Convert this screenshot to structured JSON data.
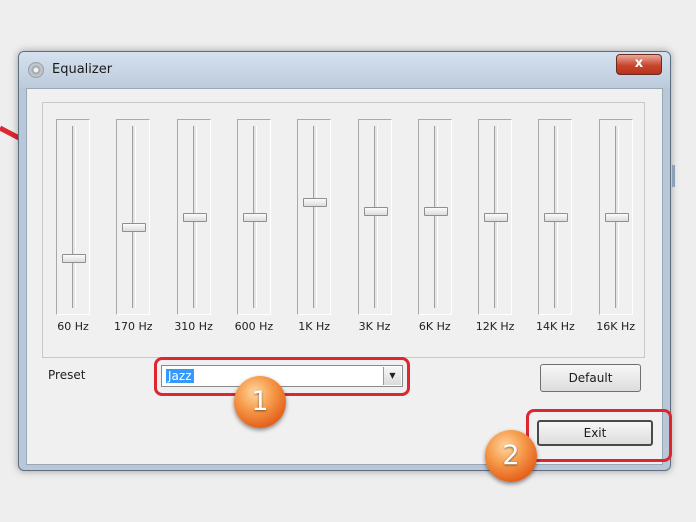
{
  "window": {
    "title": "Equalizer",
    "close_label": "x"
  },
  "bands": [
    {
      "label": "60 Hz",
      "level": 0.27
    },
    {
      "label": "170 Hz",
      "level": 0.44
    },
    {
      "label": "310 Hz",
      "level": 0.5
    },
    {
      "label": "600 Hz",
      "level": 0.5
    },
    {
      "label": "1K Hz",
      "level": 0.58
    },
    {
      "label": "3K Hz",
      "level": 0.53
    },
    {
      "label": "6K Hz",
      "level": 0.53
    },
    {
      "label": "12K Hz",
      "level": 0.5
    },
    {
      "label": "14K Hz",
      "level": 0.5
    },
    {
      "label": "16K Hz",
      "level": 0.5
    }
  ],
  "preset": {
    "label": "Preset",
    "value": "Jazz"
  },
  "buttons": {
    "default_label": "Default",
    "exit_label": "Exit"
  },
  "annotations": {
    "badge_1": "1",
    "badge_2": "2"
  },
  "colors": {
    "highlight": "#dc2630",
    "badge": "#e9702a",
    "selection": "#3399ff"
  }
}
